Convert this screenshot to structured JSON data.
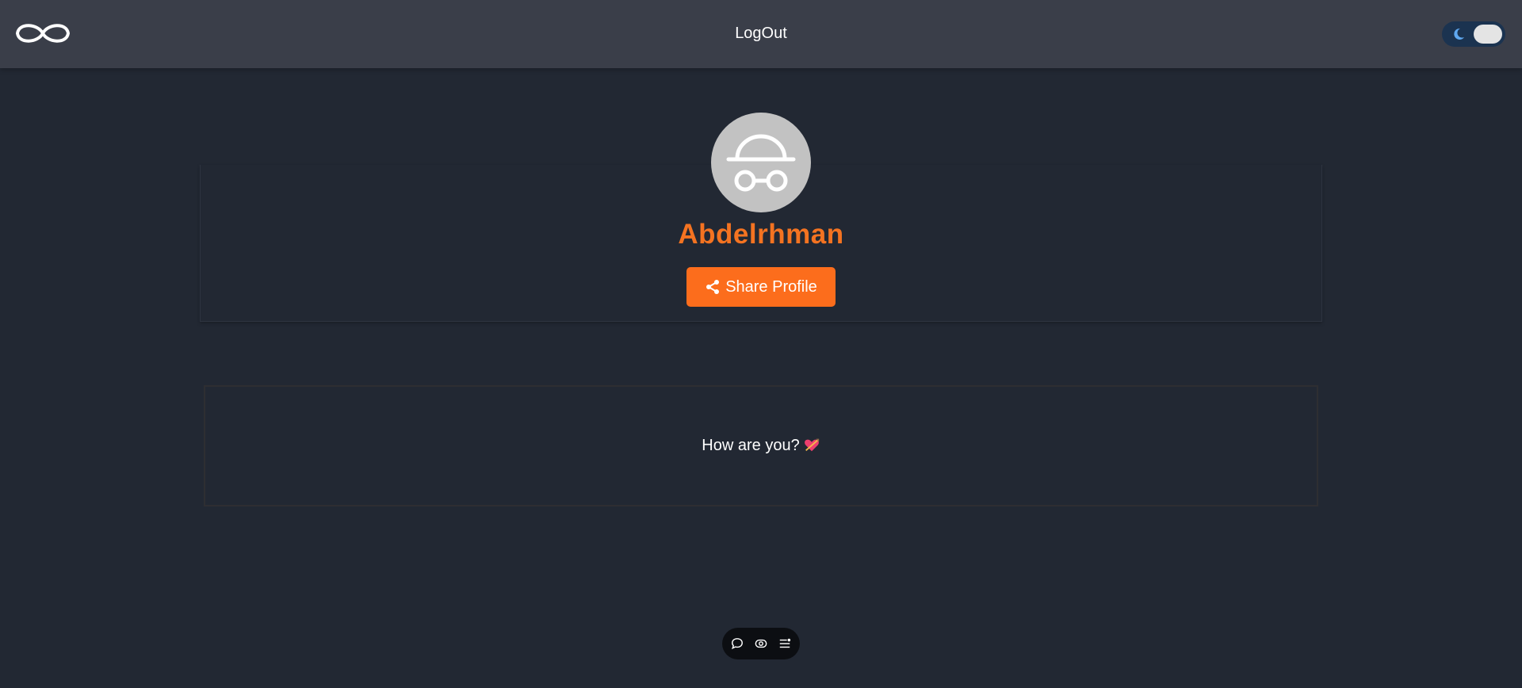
{
  "header": {
    "logout_label": "LogOut",
    "logo_icon": "infinity-icon",
    "theme_toggle": {
      "icon": "moon-icon",
      "state": "dark"
    }
  },
  "profile": {
    "avatar_icon": "incognito-icon",
    "username": "Abdelrhman",
    "share_button_label": "Share Profile",
    "share_icon": "share-icon"
  },
  "message": {
    "text": "How are you?",
    "emoji_icon": "heart-with-arrow-icon"
  },
  "dock": {
    "items": [
      {
        "icon": "chat-bubble-icon"
      },
      {
        "icon": "eye-icon"
      },
      {
        "icon": "list-settings-icon"
      }
    ]
  },
  "colors": {
    "background": "#222833",
    "header": "#3a3e49",
    "accent": "#fc6d1c",
    "username": "#f47321",
    "avatar_bg": "#c2c2c2"
  }
}
